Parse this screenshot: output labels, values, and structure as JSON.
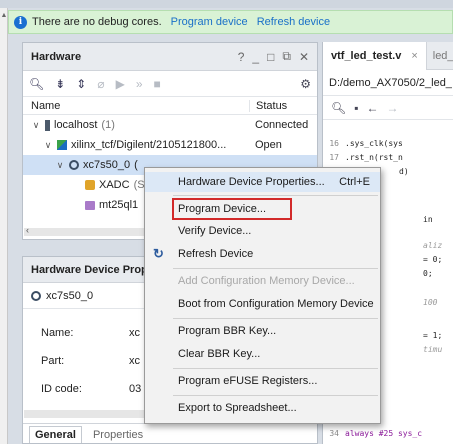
{
  "banner": {
    "message": "There are no debug cores.",
    "link_program": "Program device",
    "link_refresh": "Refresh device"
  },
  "hardware": {
    "title": "Hardware",
    "controls": [
      "?",
      "_",
      "□",
      "⧉",
      "✕"
    ],
    "columns": {
      "name": "Name",
      "status": "Status"
    },
    "rows": [
      {
        "label": "localhost",
        "count": "(1)",
        "status": "Connected"
      },
      {
        "label": "xilinx_tcf/Digilent/2105121800...",
        "status": "Open"
      },
      {
        "label": "xc7s50_0",
        "count": "(",
        "status": ""
      },
      {
        "label": "XADC",
        "count": "(S",
        "status": ""
      },
      {
        "label": "mt25ql1",
        "status": ""
      }
    ]
  },
  "properties": {
    "title": "Hardware Device Prope",
    "device": "xc7s50_0",
    "rows": [
      {
        "label": "Name:",
        "value": "xc"
      },
      {
        "label": "Part:",
        "value": "xc"
      },
      {
        "label": "ID code:",
        "value": "03"
      }
    ],
    "tabs": {
      "general": "General",
      "properties": "Properties"
    }
  },
  "editor": {
    "tab_active": "vtf_led_test.v",
    "tab_close": "×",
    "tab_other": "led_",
    "path": "D:/demo_AX7050/2_led_",
    "lines": [
      {
        "num": "16",
        "code": ".sys_clk(sys"
      },
      {
        "num": "17",
        "code": ".rst_n(rst_n"
      },
      {
        "num": "",
        "code": "d)"
      },
      {
        "num": "",
        "code": "in"
      },
      {
        "num": "",
        "code": "aliz"
      },
      {
        "num": "",
        "code": "= 0;"
      },
      {
        "num": "",
        "code": "0;"
      },
      {
        "num": "",
        "code": "100"
      },
      {
        "num": "",
        "code": "= 1;"
      },
      {
        "num": "",
        "code": "timu"
      },
      {
        "num": "34",
        "code": "always #25 sys_c"
      }
    ]
  },
  "context_menu": {
    "items": [
      {
        "label": "Hardware Device Properties...",
        "shortcut": "Ctrl+E"
      },
      {
        "label": "Program Device..."
      },
      {
        "label": "Verify Device..."
      },
      {
        "label": "Refresh Device"
      },
      {
        "label": "Add Configuration Memory Device..."
      },
      {
        "label": "Boot from Configuration Memory Device"
      },
      {
        "label": "Program BBR Key..."
      },
      {
        "label": "Clear BBR Key..."
      },
      {
        "label": "Program eFUSE Registers..."
      },
      {
        "label": "Export to Spreadsheet..."
      }
    ]
  },
  "colors": {
    "banner_bg": "#d9f2d5",
    "link": "#1a70c8",
    "highlight_border": "#d22a2a",
    "selection": "#cfe0f5"
  }
}
